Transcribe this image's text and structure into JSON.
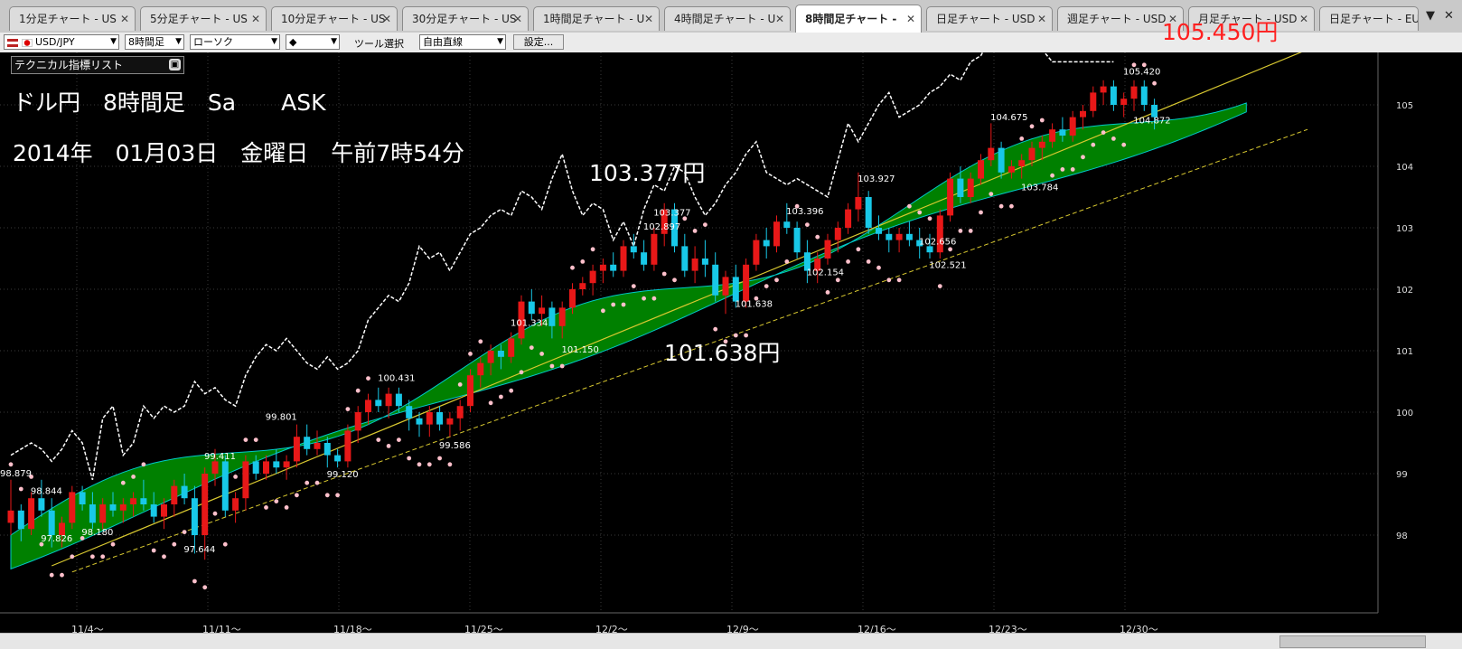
{
  "tabs": [
    {
      "label": "1分足チャート - US"
    },
    {
      "label": "5分足チャート - US"
    },
    {
      "label": "10分足チャート - US"
    },
    {
      "label": "30分足チャート - US"
    },
    {
      "label": "1時間足チャート - U"
    },
    {
      "label": "4時間足チャート - U"
    },
    {
      "label": "8時間足チャート -"
    },
    {
      "label": "日足チャート - USD"
    },
    {
      "label": "週足チャート - USD"
    },
    {
      "label": "月足チャート - USD"
    },
    {
      "label": "日足チャート - EUR/"
    }
  ],
  "toolbar": {
    "pair": "USD/JPY",
    "interval": "8時間足",
    "chart_style": "ローソク",
    "color_glyph": "◆",
    "tool_label": "ツール選択",
    "tool_value": "自由直線",
    "settings": "設定..."
  },
  "overlay": {
    "indicator_list": "テクニカル指標リスト",
    "title_line": "ドル円　8時間足　Sa　　ASK",
    "date_line": "2014年　01月03日　金曜日　午前7時54分",
    "annot_high": "103.377円",
    "annot_low": "101.638円",
    "annot_current": "105.450円"
  },
  "colors": {
    "bull": "#e81818",
    "bear": "#18c8e8",
    "cloud": "#008000",
    "cloud_edge": "#00c8c8",
    "sar": "#ffc0cb",
    "current_price": "#ff2020"
  },
  "chart_data": {
    "type": "candlestick",
    "symbol": "USD/JPY",
    "timeframe": "8時間足",
    "y_ticks": [
      98,
      99,
      100,
      101,
      102,
      103,
      104,
      105
    ],
    "x_ticks": [
      "11/4～",
      "11/11～",
      "11/18～",
      "11/25～",
      "12/2～",
      "12/9～",
      "12/16～",
      "12/23～",
      "12/30～"
    ],
    "price_labels": [
      "98.879",
      "98.844",
      "97.826",
      "98.180",
      "97.644",
      "99.411",
      "99.801",
      "99.120",
      "100.431",
      "99.586",
      "101.334",
      "101.150",
      "102.897",
      "103.377",
      "101.638",
      "103.396",
      "102.154",
      "103.927",
      "102.656",
      "102.521",
      "104.675",
      "103.784",
      "105.420",
      "104.872"
    ],
    "current_price": 105.45,
    "ohlc": [
      [
        98.2,
        98.9,
        98.0,
        98.4
      ],
      [
        98.4,
        98.5,
        97.9,
        98.1
      ],
      [
        98.1,
        98.7,
        98.0,
        98.6
      ],
      [
        98.6,
        98.9,
        98.3,
        98.4
      ],
      [
        98.4,
        98.6,
        97.8,
        98.0
      ],
      [
        98.0,
        98.3,
        97.8,
        98.2
      ],
      [
        98.2,
        98.8,
        98.1,
        98.7
      ],
      [
        98.7,
        98.8,
        98.4,
        98.5
      ],
      [
        98.5,
        98.7,
        98.1,
        98.2
      ],
      [
        98.2,
        98.6,
        98.1,
        98.5
      ],
      [
        98.5,
        98.7,
        98.3,
        98.4
      ],
      [
        98.4,
        98.6,
        98.2,
        98.5
      ],
      [
        98.5,
        98.7,
        98.3,
        98.6
      ],
      [
        98.6,
        98.9,
        98.4,
        98.5
      ],
      [
        98.5,
        98.7,
        98.2,
        98.3
      ],
      [
        98.3,
        98.6,
        98.1,
        98.5
      ],
      [
        98.5,
        98.9,
        98.3,
        98.8
      ],
      [
        98.8,
        99.0,
        98.5,
        98.6
      ],
      [
        98.6,
        98.8,
        97.7,
        98.0
      ],
      [
        98.0,
        99.1,
        97.6,
        99.0
      ],
      [
        99.0,
        99.4,
        98.8,
        99.2
      ],
      [
        99.2,
        99.3,
        98.3,
        98.4
      ],
      [
        98.4,
        98.7,
        98.2,
        98.6
      ],
      [
        98.6,
        99.3,
        98.4,
        99.2
      ],
      [
        99.2,
        99.3,
        98.9,
        99.0
      ],
      [
        99.0,
        99.3,
        98.9,
        99.2
      ],
      [
        99.2,
        99.4,
        99.0,
        99.1
      ],
      [
        99.1,
        99.3,
        98.9,
        99.2
      ],
      [
        99.2,
        99.8,
        99.1,
        99.6
      ],
      [
        99.6,
        99.8,
        99.3,
        99.4
      ],
      [
        99.4,
        99.7,
        99.3,
        99.5
      ],
      [
        99.5,
        99.6,
        99.1,
        99.3
      ],
      [
        99.3,
        99.4,
        99.1,
        99.2
      ],
      [
        99.2,
        99.8,
        99.1,
        99.7
      ],
      [
        99.7,
        100.1,
        99.5,
        100.0
      ],
      [
        100.0,
        100.3,
        99.8,
        100.2
      ],
      [
        100.2,
        100.4,
        100.0,
        100.1
      ],
      [
        100.1,
        100.4,
        99.9,
        100.3
      ],
      [
        100.3,
        100.4,
        100.0,
        100.1
      ],
      [
        100.1,
        100.2,
        99.7,
        99.9
      ],
      [
        99.9,
        100.0,
        99.6,
        99.8
      ],
      [
        99.8,
        100.1,
        99.6,
        100.0
      ],
      [
        100.0,
        100.1,
        99.7,
        99.8
      ],
      [
        99.8,
        100.0,
        99.6,
        99.9
      ],
      [
        99.9,
        100.2,
        99.7,
        100.1
      ],
      [
        100.1,
        100.7,
        100.0,
        100.6
      ],
      [
        100.6,
        100.9,
        100.4,
        100.8
      ],
      [
        100.8,
        101.1,
        100.6,
        101.0
      ],
      [
        101.0,
        101.1,
        100.7,
        100.9
      ],
      [
        100.9,
        101.3,
        100.8,
        101.2
      ],
      [
        101.2,
        101.9,
        101.1,
        101.8
      ],
      [
        101.8,
        102.0,
        101.5,
        101.6
      ],
      [
        101.6,
        101.9,
        101.4,
        101.7
      ],
      [
        101.7,
        101.8,
        101.2,
        101.4
      ],
      [
        101.4,
        101.8,
        101.2,
        101.7
      ],
      [
        101.7,
        102.1,
        101.6,
        102.0
      ],
      [
        102.0,
        102.2,
        101.9,
        102.1
      ],
      [
        102.1,
        102.4,
        101.9,
        102.3
      ],
      [
        102.3,
        102.5,
        102.1,
        102.4
      ],
      [
        102.4,
        102.6,
        102.2,
        102.3
      ],
      [
        102.3,
        102.8,
        102.2,
        102.7
      ],
      [
        102.7,
        102.9,
        102.5,
        102.6
      ],
      [
        102.6,
        102.8,
        102.3,
        102.4
      ],
      [
        102.4,
        103.0,
        102.3,
        102.9
      ],
      [
        102.9,
        103.4,
        102.7,
        103.3
      ],
      [
        103.3,
        103.4,
        102.6,
        102.7
      ],
      [
        102.7,
        102.9,
        102.2,
        102.3
      ],
      [
        102.3,
        102.7,
        102.1,
        102.5
      ],
      [
        102.5,
        102.8,
        102.2,
        102.4
      ],
      [
        102.4,
        102.6,
        101.8,
        101.9
      ],
      [
        101.9,
        102.3,
        101.6,
        102.2
      ],
      [
        102.2,
        102.4,
        101.7,
        101.8
      ],
      [
        101.8,
        102.5,
        101.7,
        102.4
      ],
      [
        102.4,
        102.9,
        102.3,
        102.8
      ],
      [
        102.8,
        103.0,
        102.5,
        102.7
      ],
      [
        102.7,
        103.2,
        102.6,
        103.1
      ],
      [
        103.1,
        103.4,
        102.9,
        103.0
      ],
      [
        103.0,
        103.1,
        102.5,
        102.6
      ],
      [
        102.6,
        102.8,
        102.1,
        102.3
      ],
      [
        102.3,
        102.6,
        102.1,
        102.5
      ],
      [
        102.5,
        102.9,
        102.4,
        102.8
      ],
      [
        102.8,
        103.1,
        102.6,
        103.0
      ],
      [
        103.0,
        103.4,
        102.9,
        103.3
      ],
      [
        103.3,
        103.9,
        103.1,
        103.5
      ],
      [
        103.5,
        103.6,
        102.9,
        103.0
      ],
      [
        103.0,
        103.2,
        102.8,
        102.9
      ],
      [
        102.9,
        103.0,
        102.6,
        102.8
      ],
      [
        102.8,
        103.0,
        102.6,
        102.9
      ],
      [
        102.9,
        103.1,
        102.7,
        102.8
      ],
      [
        102.8,
        103.0,
        102.5,
        102.7
      ],
      [
        102.7,
        102.9,
        102.5,
        102.6
      ],
      [
        102.6,
        103.3,
        102.5,
        103.2
      ],
      [
        103.2,
        103.9,
        103.1,
        103.8
      ],
      [
        103.8,
        104.0,
        103.4,
        103.5
      ],
      [
        103.5,
        103.9,
        103.4,
        103.8
      ],
      [
        103.8,
        104.2,
        103.7,
        104.1
      ],
      [
        104.1,
        104.7,
        104.0,
        104.3
      ],
      [
        104.3,
        104.4,
        103.8,
        103.9
      ],
      [
        103.9,
        104.1,
        103.8,
        104.0
      ],
      [
        104.0,
        104.2,
        103.8,
        104.1
      ],
      [
        104.1,
        104.4,
        104.0,
        104.3
      ],
      [
        104.3,
        104.5,
        104.1,
        104.4
      ],
      [
        104.4,
        104.7,
        104.3,
        104.6
      ],
      [
        104.6,
        104.8,
        104.4,
        104.5
      ],
      [
        104.5,
        104.9,
        104.4,
        104.8
      ],
      [
        104.8,
        105.0,
        104.6,
        104.9
      ],
      [
        104.9,
        105.3,
        104.8,
        105.2
      ],
      [
        105.2,
        105.4,
        105.0,
        105.3
      ],
      [
        105.3,
        105.4,
        104.9,
        105.0
      ],
      [
        105.0,
        105.2,
        104.8,
        105.1
      ],
      [
        105.1,
        105.4,
        104.9,
        105.3
      ],
      [
        105.3,
        105.4,
        104.9,
        105.0
      ],
      [
        105.0,
        105.1,
        104.6,
        104.8
      ]
    ]
  }
}
